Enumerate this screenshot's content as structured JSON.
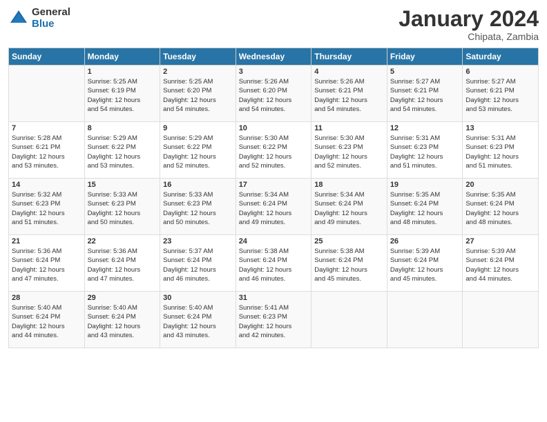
{
  "header": {
    "logo_general": "General",
    "logo_blue": "Blue",
    "month_title": "January 2024",
    "subtitle": "Chipata, Zambia"
  },
  "columns": [
    "Sunday",
    "Monday",
    "Tuesday",
    "Wednesday",
    "Thursday",
    "Friday",
    "Saturday"
  ],
  "weeks": [
    [
      {
        "day": "",
        "info": ""
      },
      {
        "day": "1",
        "info": "Sunrise: 5:25 AM\nSunset: 6:19 PM\nDaylight: 12 hours\nand 54 minutes."
      },
      {
        "day": "2",
        "info": "Sunrise: 5:25 AM\nSunset: 6:20 PM\nDaylight: 12 hours\nand 54 minutes."
      },
      {
        "day": "3",
        "info": "Sunrise: 5:26 AM\nSunset: 6:20 PM\nDaylight: 12 hours\nand 54 minutes."
      },
      {
        "day": "4",
        "info": "Sunrise: 5:26 AM\nSunset: 6:21 PM\nDaylight: 12 hours\nand 54 minutes."
      },
      {
        "day": "5",
        "info": "Sunrise: 5:27 AM\nSunset: 6:21 PM\nDaylight: 12 hours\nand 54 minutes."
      },
      {
        "day": "6",
        "info": "Sunrise: 5:27 AM\nSunset: 6:21 PM\nDaylight: 12 hours\nand 53 minutes."
      }
    ],
    [
      {
        "day": "7",
        "info": "Sunrise: 5:28 AM\nSunset: 6:21 PM\nDaylight: 12 hours\nand 53 minutes."
      },
      {
        "day": "8",
        "info": "Sunrise: 5:29 AM\nSunset: 6:22 PM\nDaylight: 12 hours\nand 53 minutes."
      },
      {
        "day": "9",
        "info": "Sunrise: 5:29 AM\nSunset: 6:22 PM\nDaylight: 12 hours\nand 52 minutes."
      },
      {
        "day": "10",
        "info": "Sunrise: 5:30 AM\nSunset: 6:22 PM\nDaylight: 12 hours\nand 52 minutes."
      },
      {
        "day": "11",
        "info": "Sunrise: 5:30 AM\nSunset: 6:23 PM\nDaylight: 12 hours\nand 52 minutes."
      },
      {
        "day": "12",
        "info": "Sunrise: 5:31 AM\nSunset: 6:23 PM\nDaylight: 12 hours\nand 51 minutes."
      },
      {
        "day": "13",
        "info": "Sunrise: 5:31 AM\nSunset: 6:23 PM\nDaylight: 12 hours\nand 51 minutes."
      }
    ],
    [
      {
        "day": "14",
        "info": "Sunrise: 5:32 AM\nSunset: 6:23 PM\nDaylight: 12 hours\nand 51 minutes."
      },
      {
        "day": "15",
        "info": "Sunrise: 5:33 AM\nSunset: 6:23 PM\nDaylight: 12 hours\nand 50 minutes."
      },
      {
        "day": "16",
        "info": "Sunrise: 5:33 AM\nSunset: 6:23 PM\nDaylight: 12 hours\nand 50 minutes."
      },
      {
        "day": "17",
        "info": "Sunrise: 5:34 AM\nSunset: 6:24 PM\nDaylight: 12 hours\nand 49 minutes."
      },
      {
        "day": "18",
        "info": "Sunrise: 5:34 AM\nSunset: 6:24 PM\nDaylight: 12 hours\nand 49 minutes."
      },
      {
        "day": "19",
        "info": "Sunrise: 5:35 AM\nSunset: 6:24 PM\nDaylight: 12 hours\nand 48 minutes."
      },
      {
        "day": "20",
        "info": "Sunrise: 5:35 AM\nSunset: 6:24 PM\nDaylight: 12 hours\nand 48 minutes."
      }
    ],
    [
      {
        "day": "21",
        "info": "Sunrise: 5:36 AM\nSunset: 6:24 PM\nDaylight: 12 hours\nand 47 minutes."
      },
      {
        "day": "22",
        "info": "Sunrise: 5:36 AM\nSunset: 6:24 PM\nDaylight: 12 hours\nand 47 minutes."
      },
      {
        "day": "23",
        "info": "Sunrise: 5:37 AM\nSunset: 6:24 PM\nDaylight: 12 hours\nand 46 minutes."
      },
      {
        "day": "24",
        "info": "Sunrise: 5:38 AM\nSunset: 6:24 PM\nDaylight: 12 hours\nand 46 minutes."
      },
      {
        "day": "25",
        "info": "Sunrise: 5:38 AM\nSunset: 6:24 PM\nDaylight: 12 hours\nand 45 minutes."
      },
      {
        "day": "26",
        "info": "Sunrise: 5:39 AM\nSunset: 6:24 PM\nDaylight: 12 hours\nand 45 minutes."
      },
      {
        "day": "27",
        "info": "Sunrise: 5:39 AM\nSunset: 6:24 PM\nDaylight: 12 hours\nand 44 minutes."
      }
    ],
    [
      {
        "day": "28",
        "info": "Sunrise: 5:40 AM\nSunset: 6:24 PM\nDaylight: 12 hours\nand 44 minutes."
      },
      {
        "day": "29",
        "info": "Sunrise: 5:40 AM\nSunset: 6:24 PM\nDaylight: 12 hours\nand 43 minutes."
      },
      {
        "day": "30",
        "info": "Sunrise: 5:40 AM\nSunset: 6:24 PM\nDaylight: 12 hours\nand 43 minutes."
      },
      {
        "day": "31",
        "info": "Sunrise: 5:41 AM\nSunset: 6:23 PM\nDaylight: 12 hours\nand 42 minutes."
      },
      {
        "day": "",
        "info": ""
      },
      {
        "day": "",
        "info": ""
      },
      {
        "day": "",
        "info": ""
      }
    ]
  ]
}
